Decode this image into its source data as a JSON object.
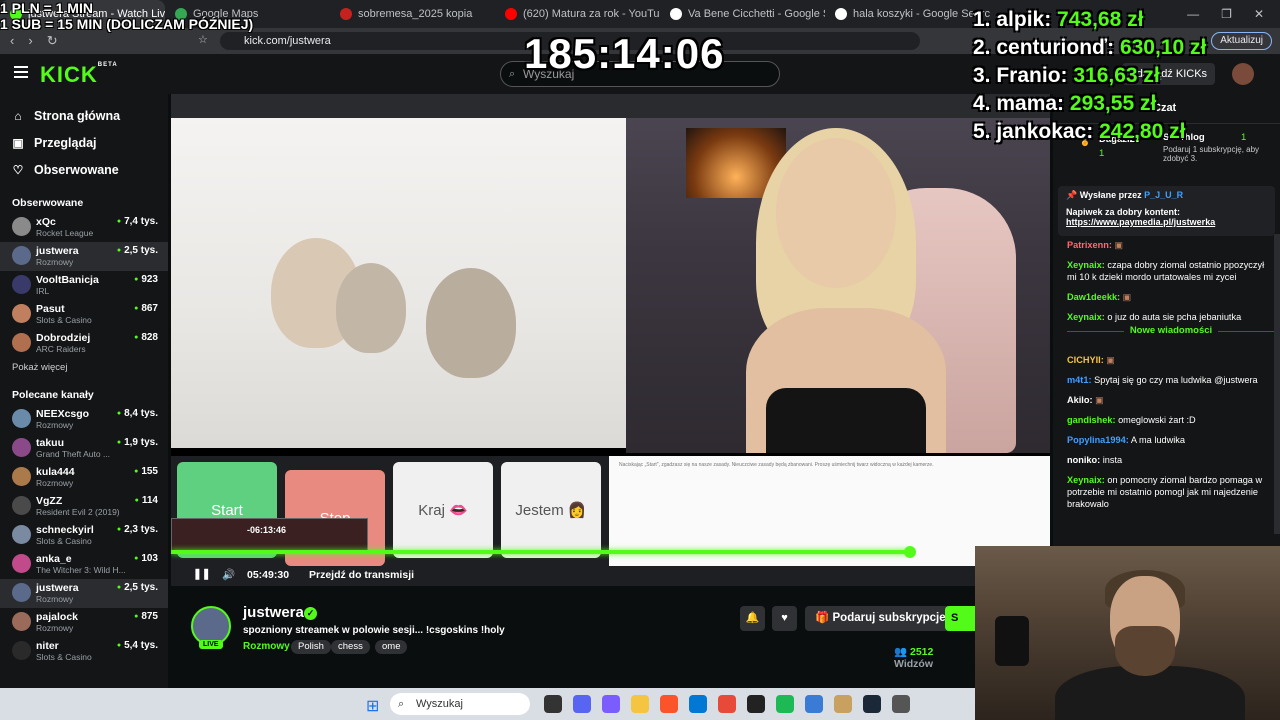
{
  "browser": {
    "tabs": [
      {
        "label": "justwera Stream - Watch Live",
        "color": "#53fc18"
      },
      {
        "label": "Google Maps",
        "color": "#34a853"
      },
      {
        "label": "sobremesa_2025 kopia",
        "color": "#c5221f"
      },
      {
        "label": "(620) Matura za rok - YouTube",
        "color": "#ff0000"
      },
      {
        "label": "Va Bene Cicchetti - Google Search",
        "color": "#ffffff"
      },
      {
        "label": "hala koszyki - Google Search",
        "color": "#ffffff"
      }
    ],
    "url": "kick.com/justwera",
    "update_label": "Aktualizuj"
  },
  "header": {
    "logo": "KICK",
    "logo_sup": "BETA",
    "search_placeholder": "Wyszukaj",
    "kicks_label": "Zdobądź KICKs"
  },
  "sidebar": {
    "nav": [
      {
        "label": "Strona główna",
        "icon": "home-icon",
        "glyph": "⌂"
      },
      {
        "label": "Przeglądaj",
        "icon": "browse-icon",
        "glyph": "▣"
      },
      {
        "label": "Obserwowane",
        "icon": "heart-icon",
        "glyph": "♡"
      }
    ],
    "followed_title": "Obserwowane",
    "followed": [
      {
        "name": "xQc",
        "category": "Rocket League",
        "viewers": "7,4 tys.",
        "color": "#8a8a8a"
      },
      {
        "name": "justwera",
        "category": "Rozmowy",
        "viewers": "2,5 tys.",
        "color": "#5b6a8a",
        "active": true
      },
      {
        "name": "VooltBanicja",
        "category": "IRL",
        "viewers": "923",
        "color": "#3a3a6a"
      },
      {
        "name": "Pasut",
        "category": "Slots & Casino",
        "viewers": "867",
        "color": "#c08060"
      },
      {
        "name": "Dobrodziej",
        "category": "ARC Raiders",
        "viewers": "828",
        "color": "#b07050"
      }
    ],
    "more_label": "Pokaż więcej",
    "recommended_title": "Polecane kanały",
    "recommended": [
      {
        "name": "NEEXcsgo",
        "category": "Rozmowy",
        "viewers": "8,4 tys.",
        "color": "#6a8aaa"
      },
      {
        "name": "takuu",
        "category": "Grand Theft Auto ...",
        "viewers": "1,9 tys.",
        "color": "#8a4a8a"
      },
      {
        "name": "kula444",
        "category": "Rozmowy",
        "viewers": "155",
        "color": "#aa7a4a"
      },
      {
        "name": "VgZZ",
        "category": "Resident Evil 2 (2019)",
        "viewers": "114",
        "color": "#4a4a4a"
      },
      {
        "name": "schneckyirl",
        "category": "Slots & Casino",
        "viewers": "2,3 tys.",
        "color": "#7a8aa0"
      },
      {
        "name": "anka_e",
        "category": "The Witcher 3: Wild H...",
        "viewers": "103",
        "color": "#c04a8a"
      },
      {
        "name": "justwera",
        "category": "Rozmowy",
        "viewers": "2,5 tys.",
        "color": "#5b6a8a",
        "active": true
      },
      {
        "name": "pajalock",
        "category": "Rozmowy",
        "viewers": "875",
        "color": "#9a6a5a"
      },
      {
        "name": "niter",
        "category": "Slots & Casino",
        "viewers": "5,4 tys.",
        "color": "#2a2a2a"
      }
    ]
  },
  "player": {
    "game_buttons": [
      {
        "label": "Start",
        "color": "#5fcf80"
      },
      {
        "label": "Stop",
        "color": "#e98a80"
      },
      {
        "label": "Kraj 👄",
        "color": "#f0f0f0"
      },
      {
        "label": "Jestem 👩",
        "color": "#f0f0f0"
      }
    ],
    "pane_text": "Naciskając „Start\", zgadzasz się na nasze zasady. Nieuczciwe zasady będą zbanowani. Proszę uśmiechnij twarz widoczną w każdej kamerze.",
    "hover_time": "-06:13:46",
    "current_time": "05:49:30",
    "jump_label": "Przejdź do transmisji",
    "progress_fraction": 0.92
  },
  "channel": {
    "name": "justwera",
    "title": "spozniony streamek w polowie sesji... !csgoskins !holy",
    "category": "Rozmowy",
    "tags": [
      "Polish",
      "chess",
      "ome"
    ],
    "live_label": "LIVE",
    "subscribe_label": "Podaruj subskrypcje",
    "follow_label": "S",
    "viewers": "2512",
    "viewers_suffix": "Widzów"
  },
  "chat": {
    "title": "Czat",
    "top_gifter": "Dagazi21",
    "top_gifter_count": "1",
    "second_gifter": "Szachlog",
    "second_gifter_count": "1",
    "gift_note": "Podaruj 1 subskrypcję, aby zdobyć 3.",
    "pinned_by_label": "Wysłane przez",
    "pinned_user": "P_J_U_R",
    "pinned_msg": "Napiwek za dobry kontent:",
    "pinned_link": "https://www.paymedia.pl/justwerka",
    "new_messages_label": "Nowe wiadomości",
    "messages_before": [
      {
        "user": "Patrixenn:",
        "text": "",
        "color": "#ff6b6b"
      },
      {
        "user": "Xeynaix:",
        "text": "czapa dobry ziomal ostatnio ppozyczył mi 10 k dzieki mordo urtatowales mi zycei",
        "color": "#53fc18"
      },
      {
        "user": "Daw1deekk:",
        "text": "",
        "color": "#53fc18"
      },
      {
        "user": "Xeynaix:",
        "text": "o juz do auta sie pcha jebaniutka",
        "color": "#53fc18"
      }
    ],
    "messages_after": [
      {
        "user": "CICHYII:",
        "text": "",
        "color": "#f5c542"
      },
      {
        "user": "m4t1:",
        "text": "Spytaj się go czy ma ludwika @justwera",
        "color": "#3fa0ff"
      },
      {
        "user": "Akilo:",
        "text": "",
        "color": "#ffffff"
      },
      {
        "user": "gandishek:",
        "text": "omeglowski żart :D",
        "color": "#53fc18"
      },
      {
        "user": "Popylina1994:",
        "text": "A ma ludwika",
        "color": "#3fa0ff"
      },
      {
        "user": "noniko:",
        "text": "insta",
        "color": "#ffffff"
      },
      {
        "user": "Xeynaix:",
        "text": "on pomocny ziomal bardzo pomaga w potrzebie mi ostatnio pomogl jak mi najedzenie brakowalo",
        "color": "#53fc18"
      }
    ]
  },
  "overlay": {
    "rate_line1": "1 PLN = 1 MIN",
    "rate_line2": "1 SUB = 15 MIN (DOLICZAM PÓŹNIEJ)",
    "timer": "185:14:06",
    "leaderboard": [
      {
        "name": "1. alpik:",
        "value": "743,68 zł"
      },
      {
        "name": "2. centurionď:",
        "value": "630,10 zł"
      },
      {
        "name": "3. Franio:",
        "value": "316,63 zł"
      },
      {
        "name": "4. mama:",
        "value": "293,55 zł"
      },
      {
        "name": "5. jankokac:",
        "value": "242,80 zł"
      }
    ]
  },
  "taskbar": {
    "search_placeholder": "Wyszukaj"
  }
}
